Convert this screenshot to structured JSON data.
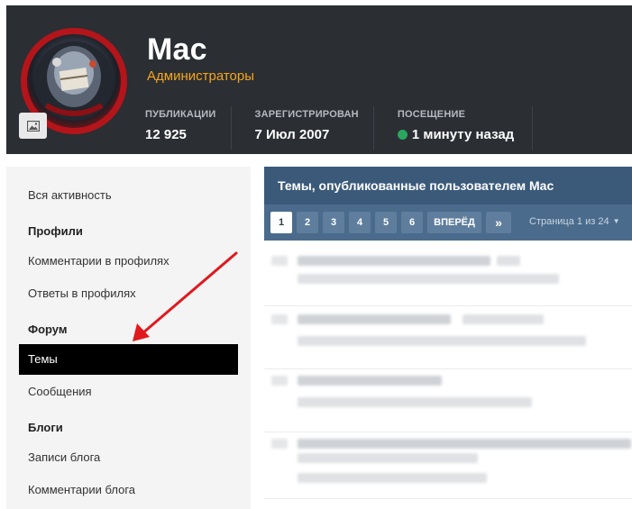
{
  "profile": {
    "name": "Mac",
    "group": "Администраторы",
    "stats": [
      {
        "label": "ПУБЛИКАЦИИ",
        "value": "12 925"
      },
      {
        "label": "ЗАРЕГИСТРИРОВАН",
        "value": "7 Июл 2007"
      },
      {
        "label": "ПОСЕЩЕНИЕ",
        "value": "1 минуту назад"
      }
    ],
    "colors": {
      "group": "#f7a51c",
      "online": "#2aa55f"
    }
  },
  "sidebar": {
    "items": [
      {
        "label": "Вся активность",
        "type": "link"
      },
      {
        "label": "Профили",
        "type": "heading"
      },
      {
        "label": "Комментарии в профилях",
        "type": "link"
      },
      {
        "label": "Ответы в профилях",
        "type": "link"
      },
      {
        "label": "Форум",
        "type": "heading"
      },
      {
        "label": "Темы",
        "type": "link",
        "active": true
      },
      {
        "label": "Сообщения",
        "type": "link"
      },
      {
        "label": "Блоги",
        "type": "heading"
      },
      {
        "label": "Записи блога",
        "type": "link"
      },
      {
        "label": "Комментарии блога",
        "type": "link"
      }
    ]
  },
  "main": {
    "title": "Темы, опубликованные пользователем Mac",
    "pagination": {
      "pages": [
        "1",
        "2",
        "3",
        "4",
        "5",
        "6"
      ],
      "current": "1",
      "next_label": "ВПЕРЁД",
      "last_label": "»",
      "info": "Страница 1 из 24"
    },
    "colors": {
      "title_bg": "#3b5a7a",
      "pager_bg": "#4b6b8c"
    }
  }
}
